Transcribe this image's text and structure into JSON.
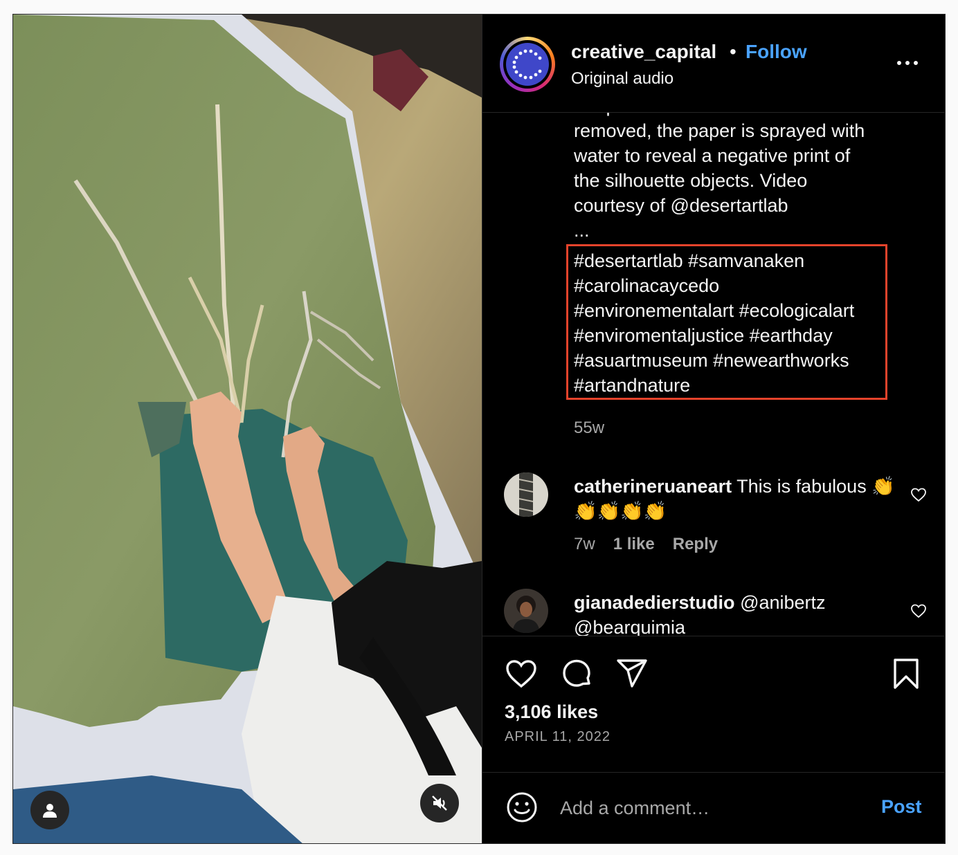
{
  "post": {
    "username": "creative_capital",
    "separator": "•",
    "follow_label": "Follow",
    "audio_label": "Original audio",
    "more_icon": "more-horizontal-icon"
  },
  "caption": {
    "lines": [
      "are placed over them. When",
      "removed, the paper is sprayed with",
      "water to reveal a negative print of",
      "the silhouette objects. Video",
      "courtesy of @desertartlab",
      "..."
    ],
    "hashtag_lines": [
      "#desertartlab #samvanaken",
      "#carolinacaycedo",
      "#environementalart #ecologicalart",
      "#enviromentaljustice #earthday",
      "#asuartmuseum #newearthworks",
      "#artandnature"
    ],
    "time": "55w"
  },
  "comments": [
    {
      "user": "catherineruaneart",
      "text": "This is fabulous 👏👏👏👏👏",
      "time": "7w",
      "likes": "1 like",
      "reply": "Reply"
    },
    {
      "user": "gianadedierstudio",
      "text": "@anibertz @bearquimia"
    }
  ],
  "stats": {
    "likes": "3,106 likes",
    "date": "APRIL 11, 2022"
  },
  "composer": {
    "placeholder": "Add a comment…",
    "post_label": "Post"
  },
  "colors": {
    "link": "#4aa3ff",
    "highlight_box": "#e5432b",
    "background": "#000000",
    "muted_text": "#a8a8a8"
  }
}
